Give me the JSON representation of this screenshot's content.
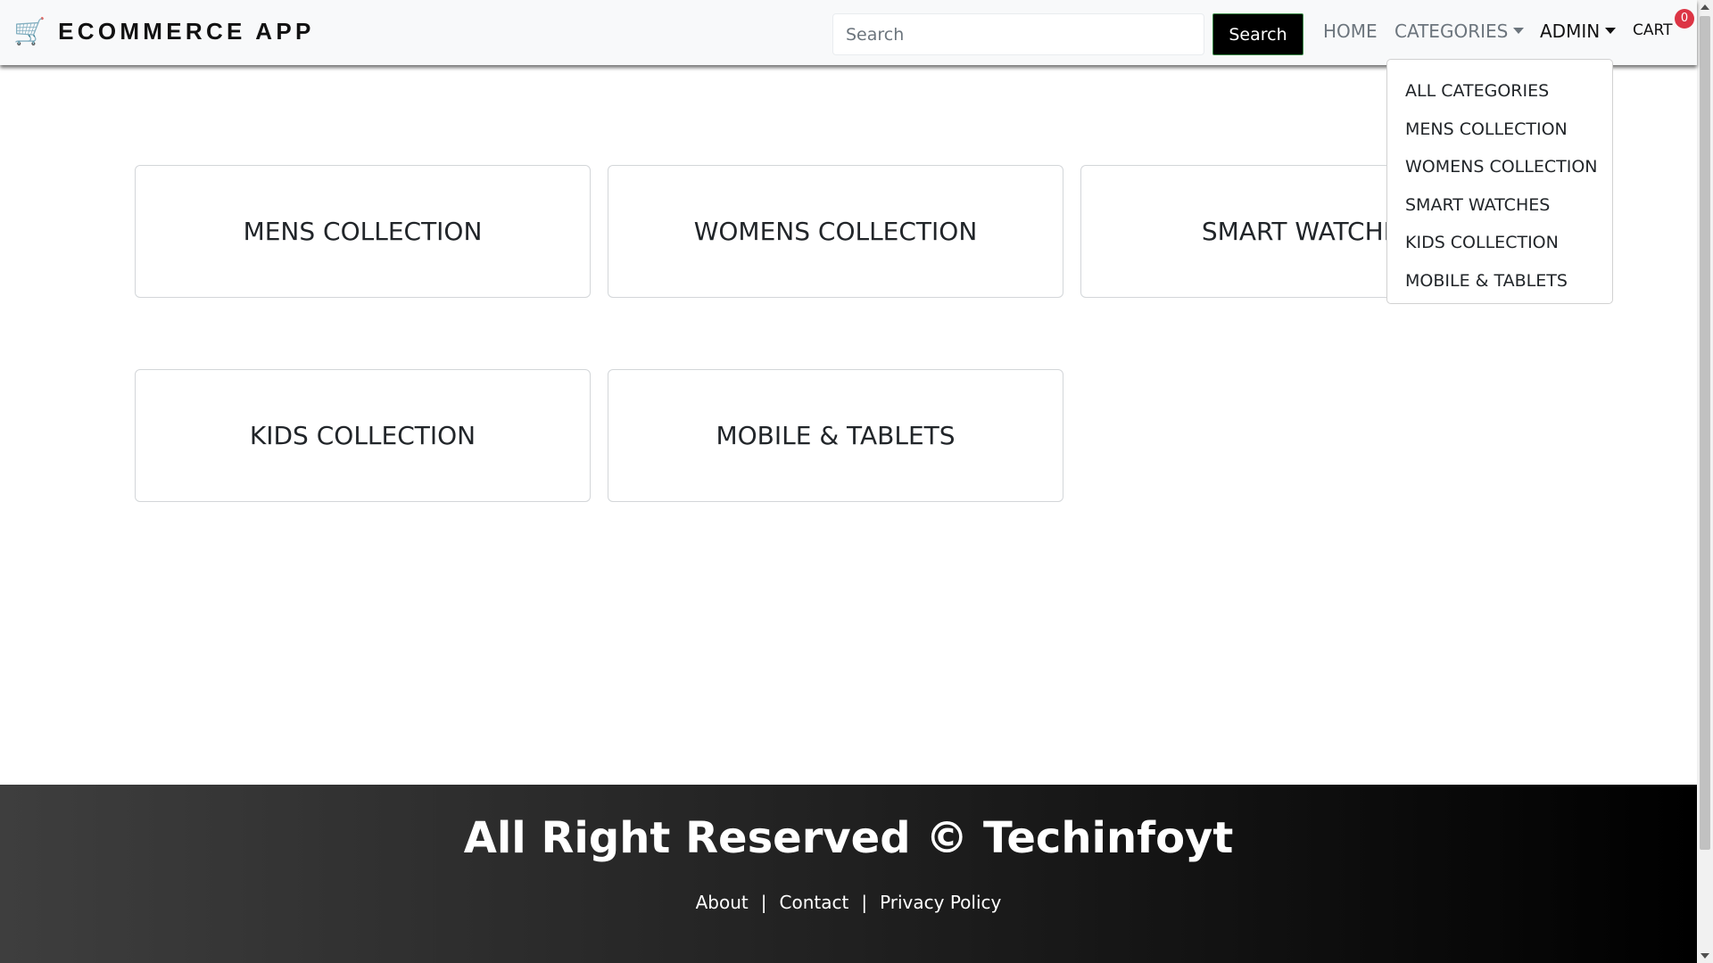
{
  "navbar": {
    "brand": "ECOMMERCE APP",
    "brand_icon": "shopping-cart-icon",
    "search": {
      "placeholder": "Search",
      "value": ""
    },
    "search_button": "Search",
    "links": {
      "home": "HOME",
      "categories": "CATEGORIES",
      "admin": "ADMIN",
      "cart": "CART"
    },
    "cart_count": "0"
  },
  "categories_dropdown": {
    "items": [
      "ALL CATEGORIES",
      "MENS COLLECTION",
      "WOMENS COLLECTION",
      "SMART WATCHES",
      "KIDS COLLECTION",
      "MOBILE & TABLETS"
    ]
  },
  "category_cards": [
    "MENS COLLECTION",
    "WOMENS COLLECTION",
    "SMART WATCHES",
    "KIDS COLLECTION",
    "MOBILE & TABLETS"
  ],
  "footer": {
    "copyright": "All Right Reserved © Techinfoyt",
    "links": [
      "About",
      "Contact",
      "Privacy Policy"
    ],
    "separator": "|"
  },
  "colors": {
    "badge": "#dc3545",
    "search_button_bg": "#000000",
    "navbar_bg": "#f8f9fa"
  }
}
